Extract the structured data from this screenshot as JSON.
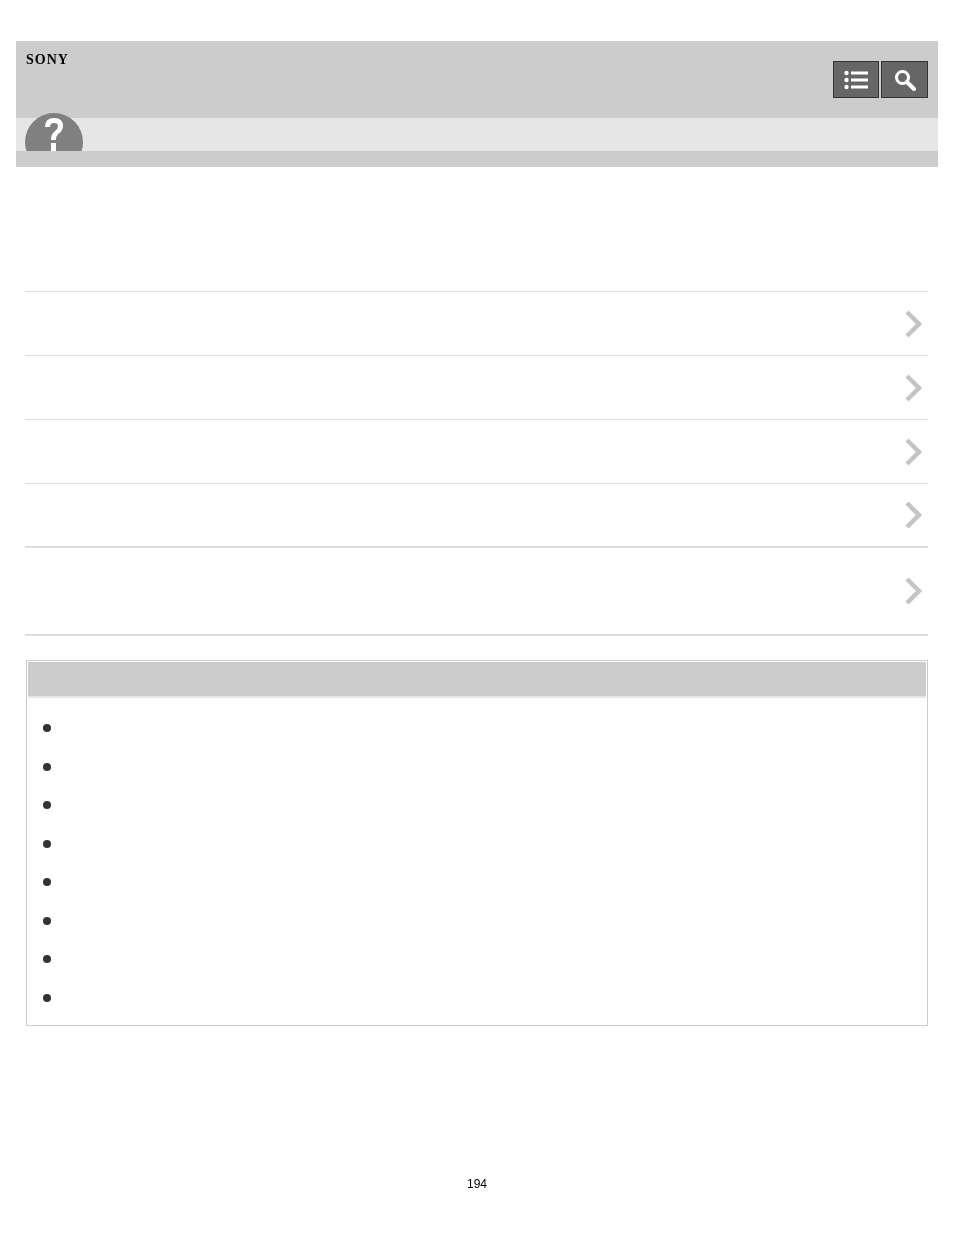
{
  "header": {
    "brand": "SONY"
  },
  "links": [
    {
      "kind": "single"
    },
    {
      "kind": "single"
    },
    {
      "kind": "single"
    },
    {
      "kind": "single"
    },
    {
      "kind": "double"
    }
  ],
  "related_box": {
    "items": [
      {
        "kind": "bullet"
      },
      {
        "kind": "bullet"
      },
      {
        "kind": "bullet"
      },
      {
        "kind": "bullet"
      },
      {
        "kind": "bullet"
      },
      {
        "kind": "bullet"
      },
      {
        "kind": "bullet"
      },
      {
        "kind": "bullet"
      }
    ]
  },
  "page_number": "194"
}
